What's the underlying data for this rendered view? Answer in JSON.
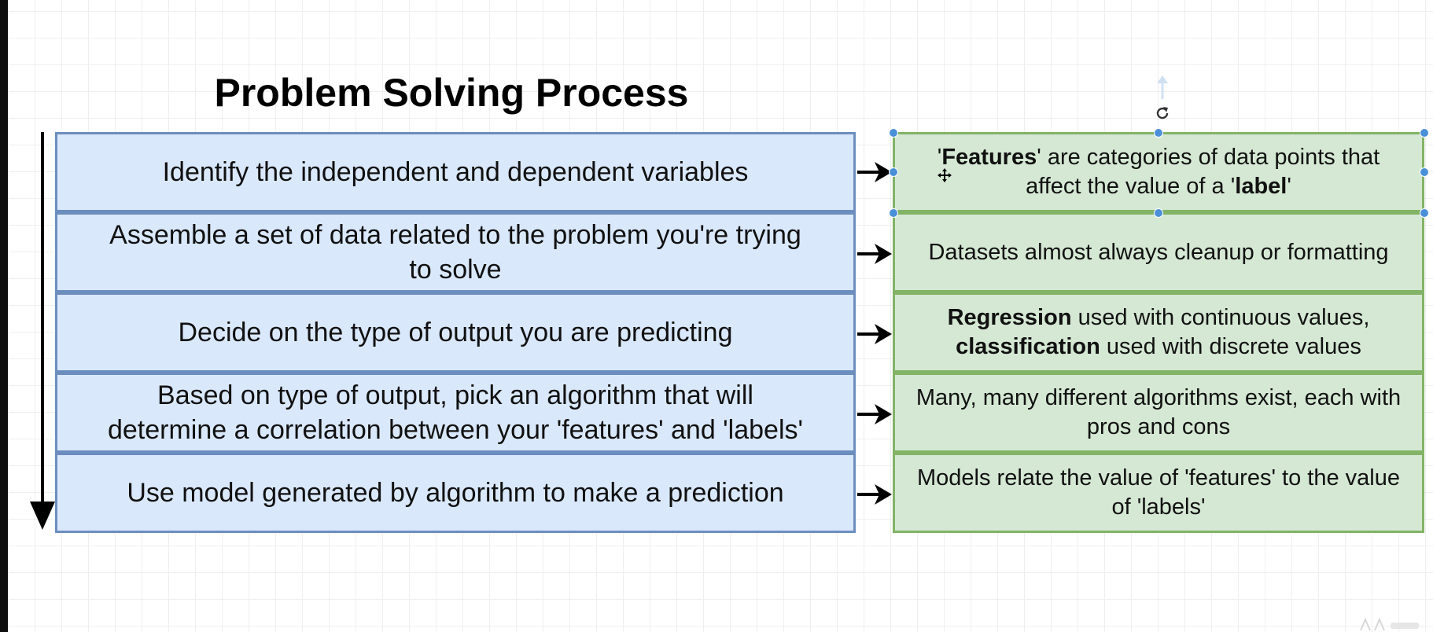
{
  "title": "Problem Solving Process",
  "steps": [
    {
      "text": "Identify the independent and dependent variables"
    },
    {
      "line1": "Assemble a set of data related to the problem you're trying",
      "line2": "to solve"
    },
    {
      "text": "Decide on the type of output you are predicting"
    },
    {
      "line1": "Based on type of output, pick an algorithm that will",
      "line2": "determine a correlation between your 'features' and 'labels'"
    },
    {
      "text": "Use model generated by algorithm to make a prediction"
    }
  ],
  "notes": [
    {
      "line1": {
        "pre": "'",
        "bold": "Features",
        "post": "' are categories of data points that"
      },
      "line2": {
        "pre": "affect the value of a '",
        "bold": "label",
        "post": "'"
      }
    },
    {
      "text": "Datasets almost always cleanup or formatting"
    },
    {
      "line1": {
        "bold": "Regression",
        "post": " used with continuous values,"
      },
      "line2": {
        "bold": "classification",
        "post": " used with discrete values"
      }
    },
    {
      "line1": "Many, many different algorithms exist, each with",
      "line2": "pros and cons"
    },
    {
      "line1": "Models relate the value of 'features' to the value",
      "line2": "of 'labels'"
    }
  ],
  "colors": {
    "step_fill": "#dae8fc",
    "step_border": "#6c8ebf",
    "note_fill": "#d5e8d4",
    "note_border": "#82b366",
    "selection_handle": "#4a90d9"
  },
  "icons": {
    "rotate": "rotate-icon",
    "move": "move-cursor-icon",
    "up_arrow": "up-arrow-icon"
  }
}
